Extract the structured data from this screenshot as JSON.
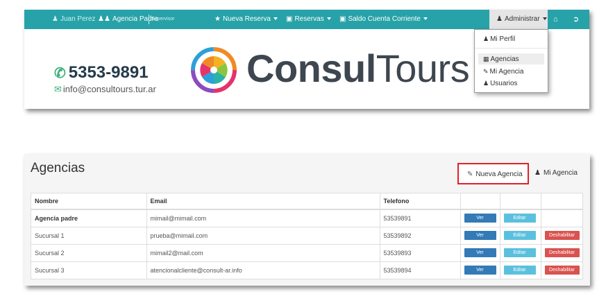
{
  "navbar": {
    "user": "Juan Perez",
    "agency": "Agencia Padre",
    "role": "Supervisor",
    "nueva_reserva": "Nueva Reserva",
    "reservas": "Reservas",
    "saldo": "Saldo Cuenta Corriente",
    "administrar": "Administrar",
    "home_icon": "home-icon",
    "logout_icon": "sign-out-icon"
  },
  "header": {
    "phone": "5353-9891",
    "email": "info@consultours.tur.ar",
    "logo_bold": "Consul",
    "logo_light": "Tours"
  },
  "admin_menu": {
    "items": [
      {
        "label": "Mi Perfil",
        "icon": "user-icon"
      },
      {
        "label": "Agencias",
        "icon": "building-icon"
      },
      {
        "label": "Mi Agencia",
        "icon": "pencil-icon"
      },
      {
        "label": "Usuarios",
        "icon": "users-icon"
      }
    ]
  },
  "page": {
    "title": "Agencias",
    "nueva_agencia": "Nueva Agencia",
    "mi_agencia": "Mi Agencia"
  },
  "table": {
    "headers": [
      "Nombre",
      "Email",
      "Telefono"
    ],
    "rows": [
      {
        "nombre": "Agencia padre",
        "email": "mimail@mimail.com",
        "telefono": "53539891"
      },
      {
        "nombre": "Sucursal 1",
        "email": "prueba@mimail.com",
        "telefono": "53539892"
      },
      {
        "nombre": "Sucursal 2",
        "email": "mimail2@mail.com",
        "telefono": "53539893"
      },
      {
        "nombre": "Sucursal 3",
        "email": "atencionalcliente@consult-ar.info",
        "telefono": "53539894"
      }
    ],
    "actions": {
      "ver": "Ver",
      "editar": "Editar",
      "deshabilitar": "Deshabilitar"
    }
  },
  "colors": {
    "navbar": "#27a2a8",
    "highlight": "#e0202a",
    "ver": "#337ab7",
    "editar": "#5bc0de",
    "deshabilitar": "#d9534f"
  }
}
